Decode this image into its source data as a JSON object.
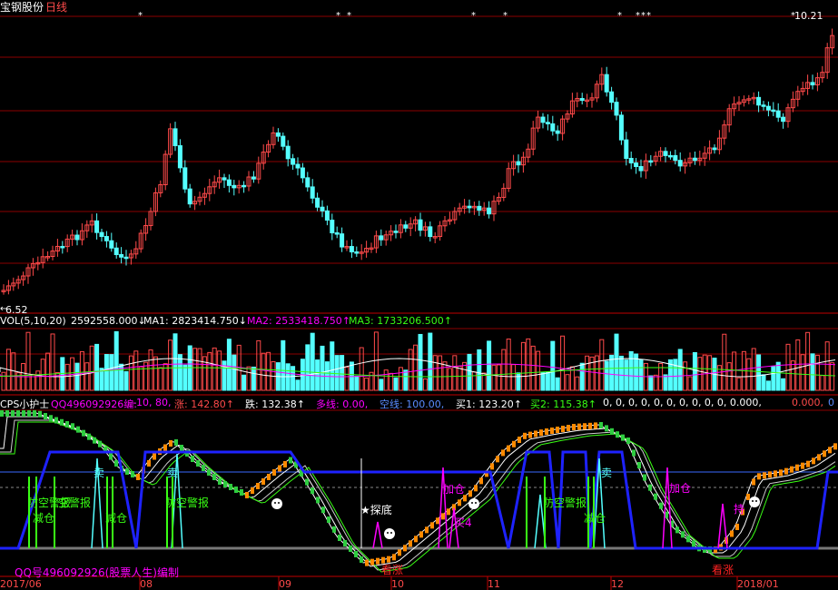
{
  "header": {
    "stock_name": "宝钢股份",
    "period": "日线",
    "price_high_label": "10.21",
    "price_low_label": "6.52"
  },
  "colors": {
    "bg": "#000000",
    "up": "#ff4a4a",
    "down": "#54ffff",
    "grid": "#8b0000",
    "white": "#ffffff",
    "magenta": "#ff00ff",
    "yellow": "#ffff00",
    "green": "#39ff14",
    "blue": "#1e22ff",
    "orange": "#ff8a00",
    "gray": "#999999"
  },
  "volume_panel": {
    "title": "VOL(5,10,20)",
    "vol_value": "2592558.000↓",
    "ma1": "MA1: 2823414.750↓",
    "ma2": "MA2: 2533418.750↑",
    "ma3": "MA3: 1733206.500↑"
  },
  "indicator_panel": {
    "title": "CPS小护士",
    "author": "QQ496092926编:",
    "params": "-10, 80,",
    "zhang": "涨: 142.80↑",
    "die": "跌: 132.38↑",
    "duoxian": "多线: 0.00,",
    "kongxian": "空线: 100.00,",
    "mai1": "买1: 123.20↑",
    "mai2": "买2: 115.38↑",
    "zeros": "0, 0, 0, 0, 0, 0, 0, 0, 0, 0, 0.000,",
    "zeros2": "0.000,",
    "tail": "0",
    "footer": "QQ号496092926(股票人生)编制",
    "signals": {
      "fangkong1": "防空警报",
      "fangkong2": "空警报",
      "fangkong3": "防空警报",
      "fangkong4": "防空警报",
      "jiancang1": "减仓",
      "jiancang2": "减仓",
      "jiancang3": "减仓",
      "tandi": "★探底",
      "kanzhang1": "看涨",
      "kanzhang2": "看涨",
      "jiacang1": "加仓",
      "jiacang2": "加仓",
      "mai4": "买4",
      "mai": "卖",
      "mai_b": "卖",
      "mai_c": "卖",
      "chi": "持"
    }
  },
  "time_axis": [
    "2017/06",
    "08",
    "09",
    "10",
    "11",
    "12",
    "2018/01"
  ]
}
